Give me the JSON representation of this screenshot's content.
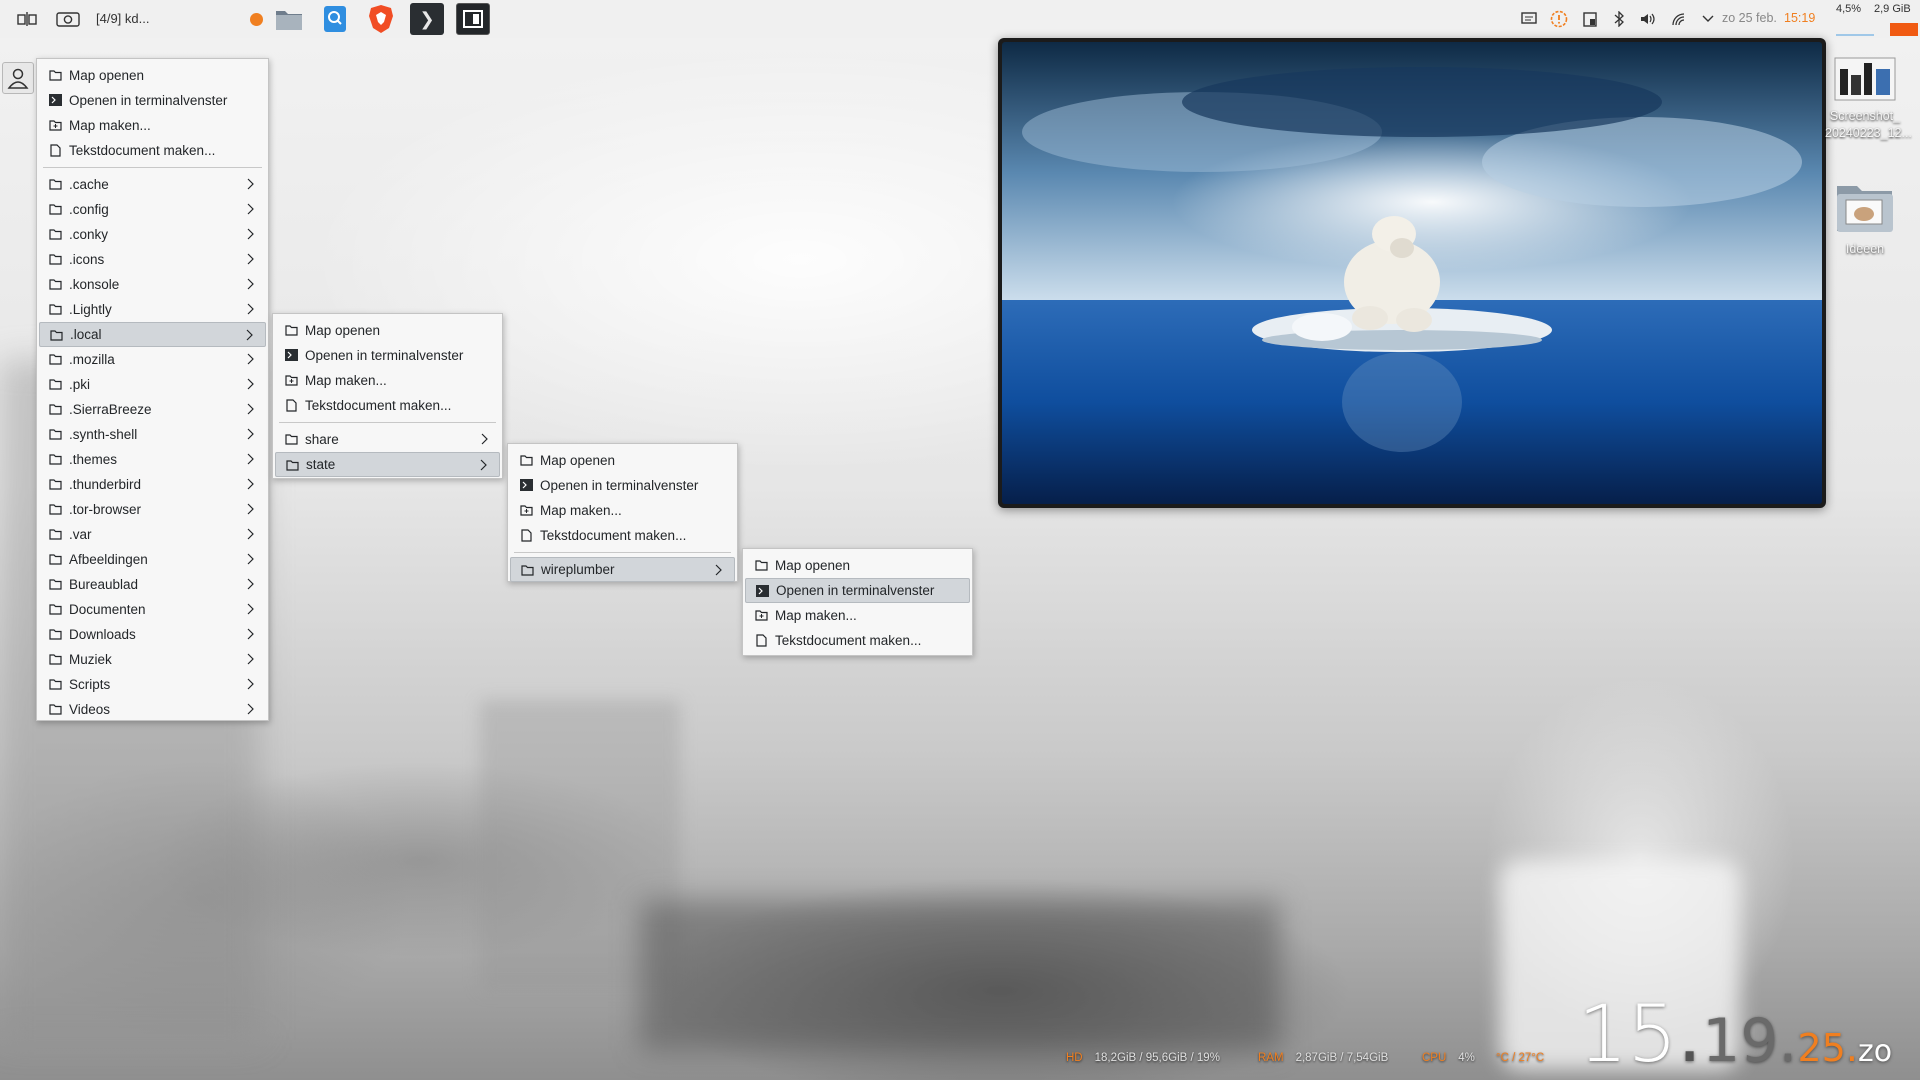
{
  "panel": {
    "pager_label": "[4/9] kd...",
    "tray": {
      "cpu_percent": "4,5%",
      "memory": "2,9 GiB",
      "date": "zo 25 feb.",
      "time": "15:19"
    }
  },
  "menus": {
    "home": {
      "actions": [
        "Map openen",
        "Openen in terminalvenster",
        "Map maken...",
        "Tekstdocument maken..."
      ],
      "folders": [
        ".cache",
        ".config",
        ".conky",
        ".icons",
        ".konsole",
        ".Lightly",
        ".local",
        ".mozilla",
        ".pki",
        ".SierraBreeze",
        ".synth-shell",
        ".themes",
        ".thunderbird",
        ".tor-browser",
        ".var",
        "Afbeeldingen",
        "Bureaublad",
        "Documenten",
        "Downloads",
        "Muziek",
        "Scripts",
        "Videos"
      ],
      "selected": ".local"
    },
    "local": {
      "actions": [
        "Map openen",
        "Openen in terminalvenster",
        "Map maken...",
        "Tekstdocument maken..."
      ],
      "folders": [
        "share",
        "state"
      ],
      "selected": "state"
    },
    "state": {
      "actions": [
        "Map openen",
        "Openen in terminalvenster",
        "Map maken...",
        "Tekstdocument maken..."
      ],
      "folders": [
        "wireplumber"
      ],
      "selected": "wireplumber"
    },
    "wireplumber": {
      "actions": [
        "Map openen",
        "Openen in terminalvenster",
        "Map maken...",
        "Tekstdocument maken..."
      ],
      "highlighted": "Openen in terminalvenster"
    }
  },
  "desktop_icons": [
    {
      "label_line1": "Screenshot_",
      "label_line2": "20240223_12..."
    },
    {
      "label_line1": "Ideeen",
      "label_line2": ""
    }
  ],
  "stats": {
    "hd_label": "HD",
    "hd_value": "18,2GiB / 95,6GiB / 19%",
    "ram_label": "RAM",
    "ram_value": "2,87GiB / 7,54GiB",
    "cpu_label": "CPU",
    "cpu_value": "4%",
    "temp_value": "°C / 27°C"
  },
  "clock": {
    "hours": "15",
    "minutes": "19",
    "day": "25",
    "weekday": "zo"
  },
  "colors": {
    "accent": "#f07f20",
    "selection": "#d2d6da"
  }
}
